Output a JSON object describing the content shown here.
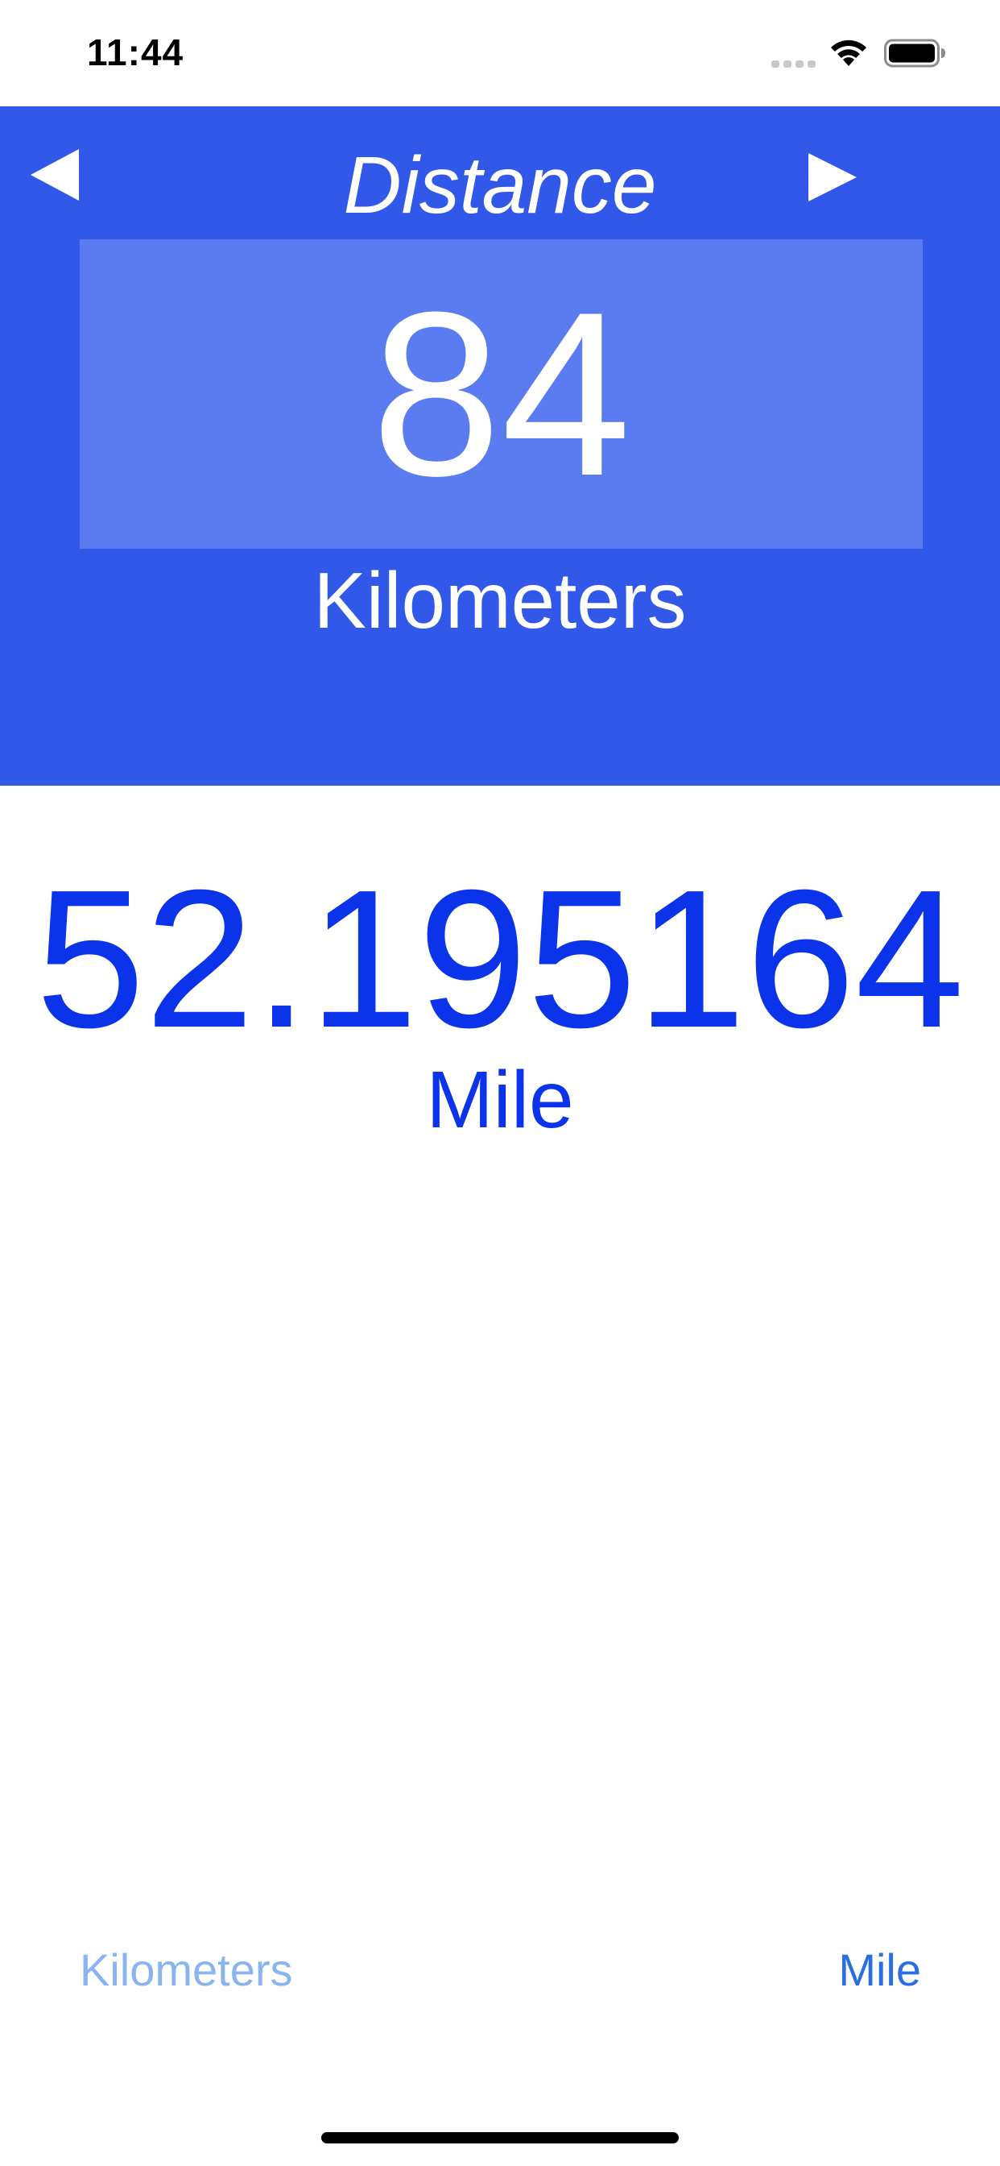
{
  "status_bar": {
    "time": "11:44",
    "icons": [
      "cellular-signal-icon",
      "wifi-icon",
      "battery-icon"
    ]
  },
  "converter": {
    "category_title": "Distance",
    "input_value": "84",
    "from_unit": "Kilometers",
    "result_value": "52.195164",
    "to_unit": "Mile",
    "nav": {
      "prev_icon": "triangle-left-icon",
      "next_icon": "triangle-right-icon"
    }
  },
  "unit_selector": {
    "left_label": "Kilometers",
    "right_label": "Mile"
  },
  "colors": {
    "header_background": "#3258ea",
    "value_box_background": "#5b7bf1",
    "result_text": "#0a33ea",
    "selector_inactive": "#8ab3f2",
    "selector_active": "#2a6ee2"
  }
}
